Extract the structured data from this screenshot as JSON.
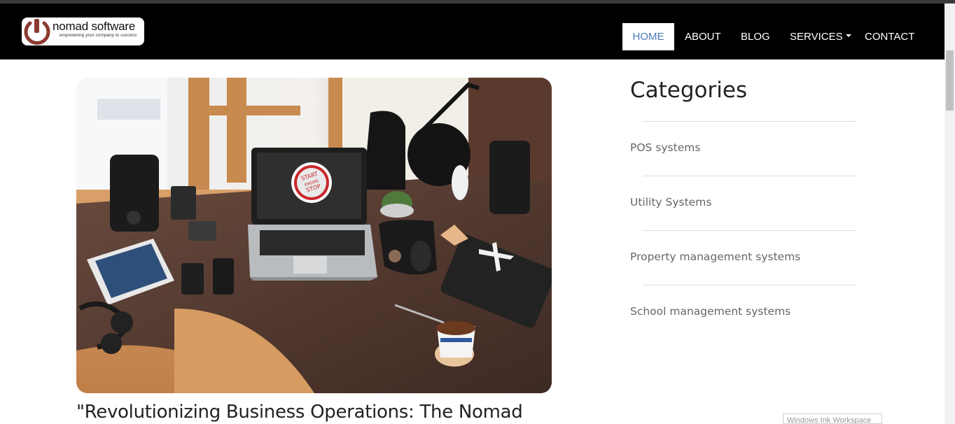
{
  "brand": {
    "name": "nomad software",
    "tagline": "empowering your company to success",
    "accent_color": "#8b3a2f"
  },
  "nav": {
    "items": [
      {
        "label": "HOME",
        "active": true
      },
      {
        "label": "ABOUT",
        "active": false
      },
      {
        "label": "BLOG",
        "active": false
      },
      {
        "label": "SERVICES",
        "active": false,
        "dropdown": true
      },
      {
        "label": "CONTACT",
        "active": false
      }
    ],
    "active_color": "#4a7bb7"
  },
  "post": {
    "image_icon": "desk-workspace-photo",
    "laptop_screen_text": [
      "START",
      "ENGINE",
      "STOP"
    ],
    "title": "\"Revolutionizing Business Operations: The Nomad"
  },
  "sidebar": {
    "heading": "Categories",
    "categories": [
      "POS systems",
      "Utility Systems",
      "Property management systems",
      "School management systems"
    ]
  },
  "overlay": {
    "ink_workspace": "Windows Ink Workspace"
  }
}
